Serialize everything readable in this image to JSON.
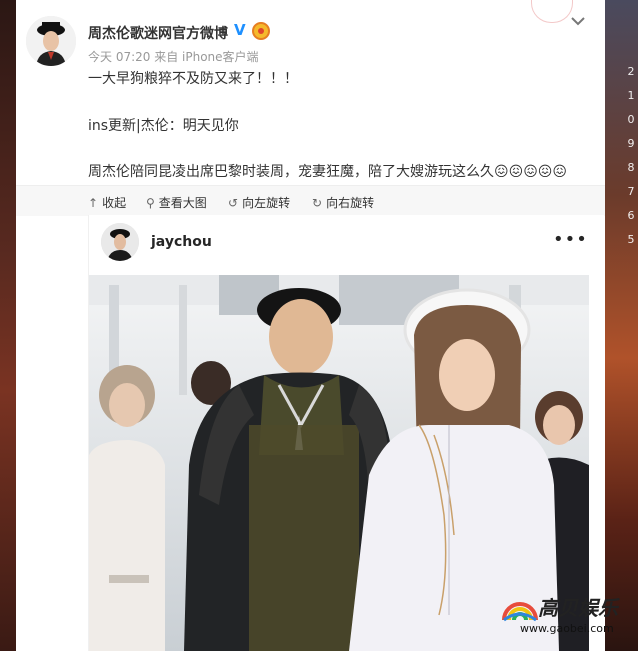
{
  "post": {
    "author": "周杰伦歌迷网官方微博",
    "verified_icon": "verified-v-icon",
    "meta": "今天 07:20 来自 iPhone客户端",
    "stamp": "",
    "lines": [
      "一大早狗粮猝不及防又来了！！！",
      "ins更新|杰伦：明天见你",
      "周杰伦陪同昆凌出席巴黎时装周，宠妻狂魔，陪了大嫂游玩这么久😖😖😖😖😖"
    ]
  },
  "toolbar": {
    "collapse": "收起",
    "view_large": "查看大图",
    "rotate_left": "向左旋转",
    "rotate_right": "向右旋转"
  },
  "instagram": {
    "username": "jaychou",
    "more": "•••"
  },
  "timeline": [
    "2",
    "1",
    "0",
    "9",
    "8",
    "7",
    "6",
    "5"
  ],
  "watermark": {
    "brand": "高贝娱乐",
    "url": "www.gaobei.com"
  },
  "colors": {
    "link_blue": "#1e90ff",
    "meta_gray": "#999999",
    "text": "#333333"
  }
}
